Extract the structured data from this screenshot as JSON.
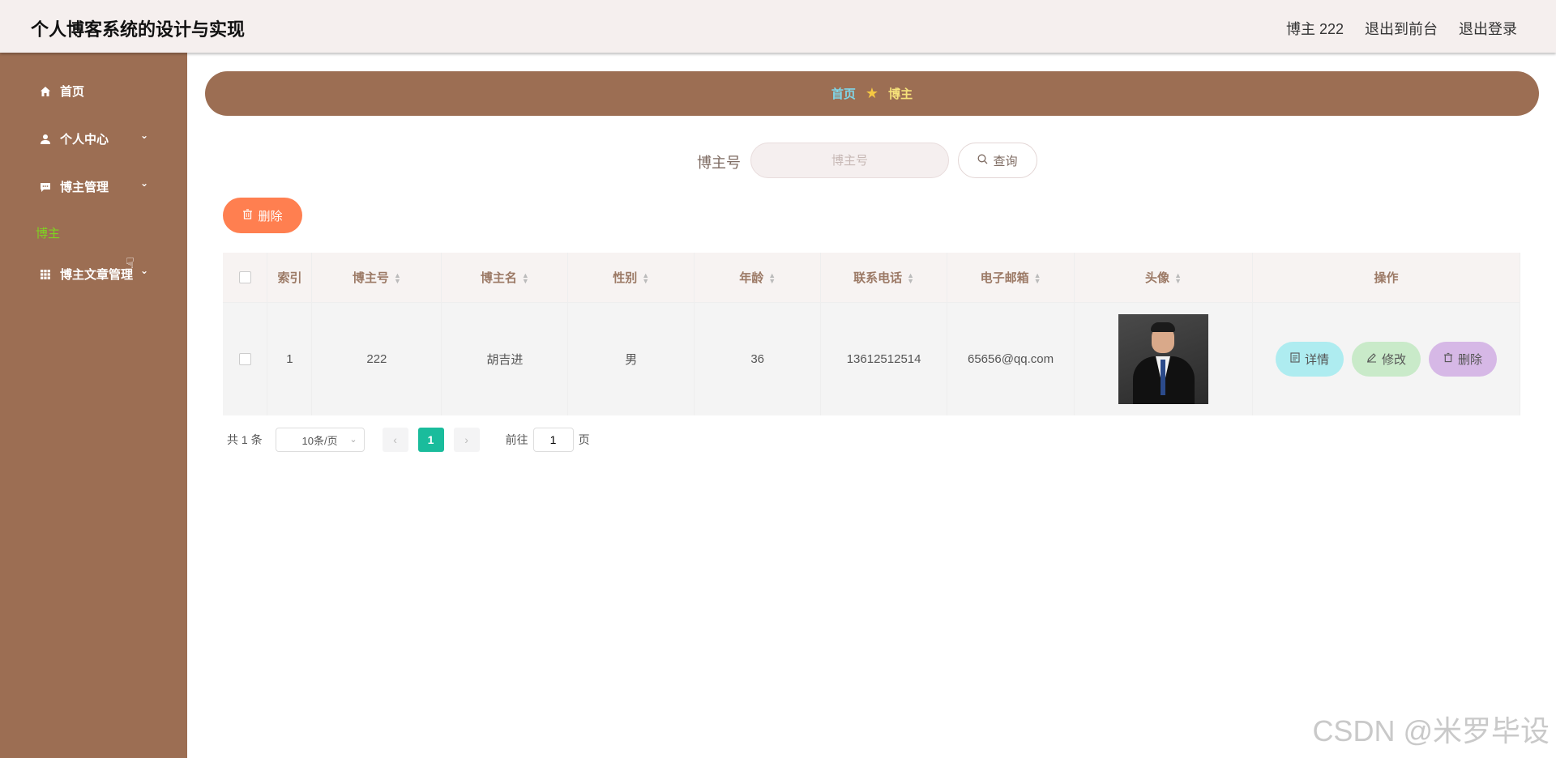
{
  "header": {
    "title": "个人博客系统的设计与实现",
    "user": "博主 222",
    "front": "退出到前台",
    "logout": "退出登录"
  },
  "sidebar": {
    "items": [
      {
        "label": "首页",
        "icon": "home-icon"
      },
      {
        "label": "个人中心",
        "icon": "user-icon"
      },
      {
        "label": "博主管理",
        "icon": "chat-icon"
      },
      {
        "label": "博主文章管理",
        "icon": "grid-icon"
      }
    ],
    "active_sub": "博主"
  },
  "breadcrumb": {
    "home": "首页",
    "current": "博主"
  },
  "search": {
    "label": "博主号",
    "placeholder": "博主号",
    "button": "查询"
  },
  "toolbar": {
    "delete": "删除"
  },
  "table": {
    "headers": [
      "索引",
      "博主号",
      "博主名",
      "性别",
      "年龄",
      "联系电话",
      "电子邮箱",
      "头像",
      "操作"
    ],
    "rows": [
      {
        "index": "1",
        "id": "222",
        "name": "胡吉进",
        "gender": "男",
        "age": "36",
        "phone": "13612512514",
        "email": "65656@qq.com"
      }
    ],
    "ops": {
      "detail": "详情",
      "edit": "修改",
      "remove": "删除"
    }
  },
  "pager": {
    "total": "共 1 条",
    "size": "10条/页",
    "current": "1",
    "goto_label": "前往",
    "goto_value": "1",
    "page_unit": "页"
  },
  "watermark": "CSDN @米罗毕设",
  "colors": {
    "sidebar": "#9c6e53",
    "header": "#f5efee",
    "accent": "#1abc9c",
    "delete": "#ff7f50"
  }
}
